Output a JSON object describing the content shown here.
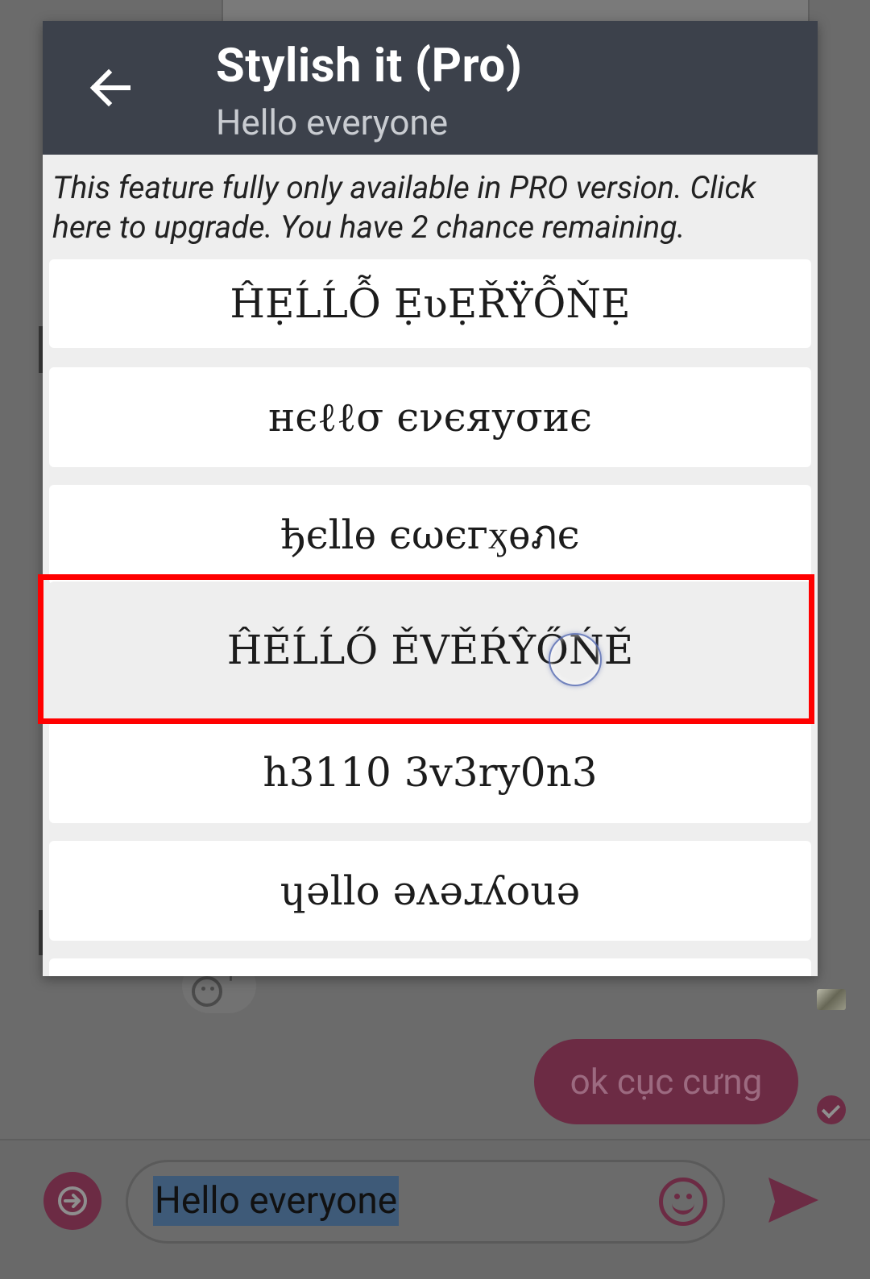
{
  "dialog": {
    "title": "Stylish it (Pro)",
    "subtitle": "Hello everyone",
    "notice": "This feature fully only available in PRO version. Click here to upgrade. You have 2 chance remaining.",
    "styles": [
      "ĤẸĹĹỖ ẸʋẸŘŸỖŇẸ",
      "нєℓℓσ єνєяуσиє",
      "ђєllѳ єωєгӽѳภє",
      "ĤĚĹĹŐ ĚVĚŔŶŐŃĚ",
      "h3110 3v3ry0n3",
      "ɥǝllo ǝʌǝɹʎouǝ"
    ],
    "selected_index": 3
  },
  "chat": {
    "outgoing_message": "ok cục cưng",
    "input_value": "Hello everyone"
  },
  "icons": {
    "back": "arrow-left-icon",
    "forward": "arrow-right-circle-icon",
    "emoji": "smiley-icon",
    "add_reaction": "add-emoji-icon",
    "send": "send-icon",
    "read_receipt": "check-circle-icon"
  },
  "colors": {
    "header_bg": "#3c414b",
    "selection_border": "#ff0000",
    "accent": "#6c2b44",
    "overlay_bg": "#6b6b6b"
  }
}
